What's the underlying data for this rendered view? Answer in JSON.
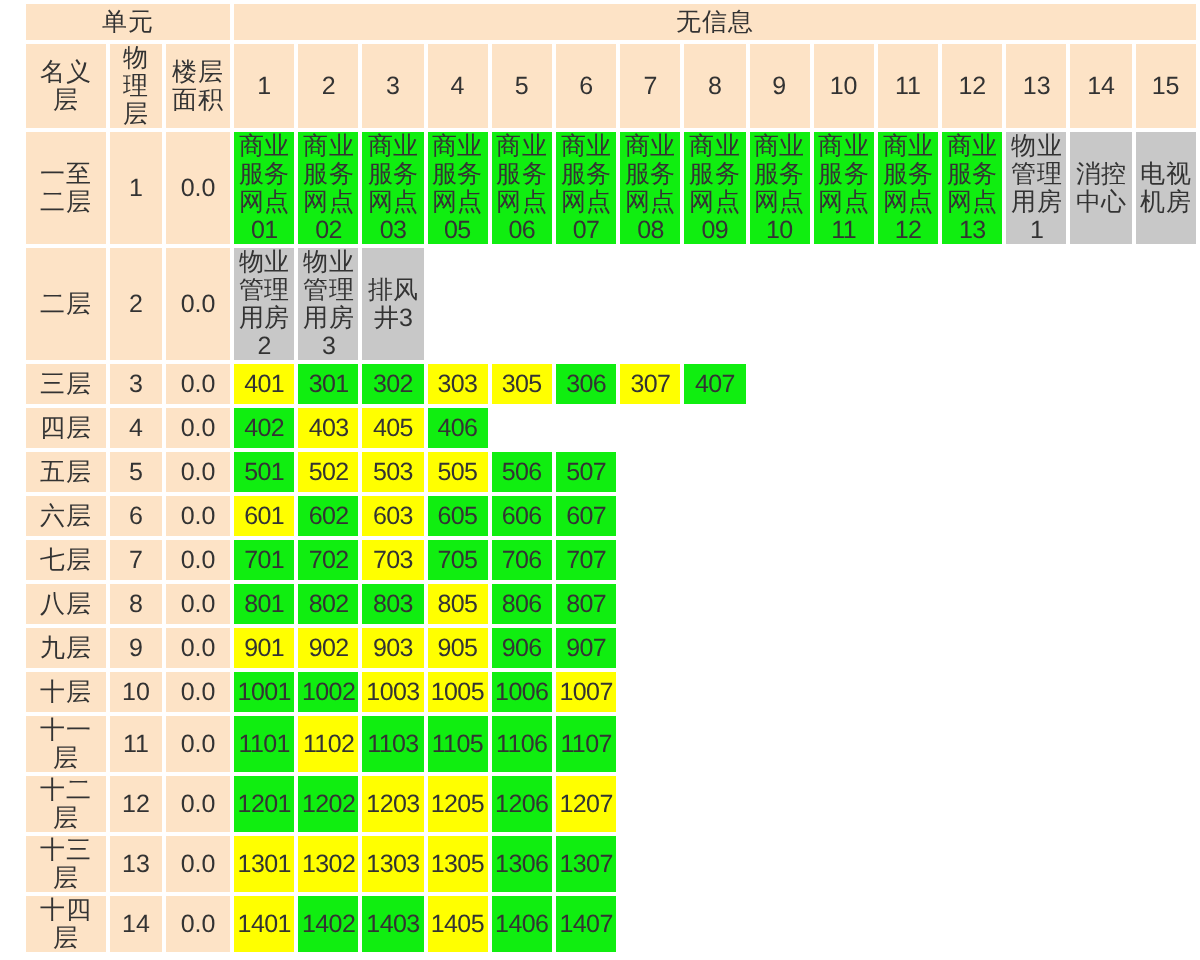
{
  "header": {
    "unit_label": "单元",
    "info_label": "无信息",
    "columns": [
      "名义层",
      "物理层",
      "楼层面积"
    ],
    "unit_numbers": [
      "1",
      "2",
      "3",
      "4",
      "5",
      "6",
      "7",
      "8",
      "9",
      "10",
      "11",
      "12",
      "13",
      "14",
      "15"
    ]
  },
  "floors": [
    {
      "name": "一至二层",
      "physical": "1",
      "area": "0.0",
      "rooms": [
        {
          "label": "商业服务网点01",
          "color": "#10ee10"
        },
        {
          "label": "商业服务网点02",
          "color": "#10ee10"
        },
        {
          "label": "商业服务网点03",
          "color": "#10ee10"
        },
        {
          "label": "商业服务网点05",
          "color": "#10ee10"
        },
        {
          "label": "商业服务网点06",
          "color": "#10ee10"
        },
        {
          "label": "商业服务网点07",
          "color": "#10ee10"
        },
        {
          "label": "商业服务网点08",
          "color": "#10ee10"
        },
        {
          "label": "商业服务网点09",
          "color": "#10ee10"
        },
        {
          "label": "商业服务网点10",
          "color": "#10ee10"
        },
        {
          "label": "商业服务网点11",
          "color": "#10ee10"
        },
        {
          "label": "商业服务网点12",
          "color": "#10ee10"
        },
        {
          "label": "商业服务网点13",
          "color": "#10ee10"
        },
        {
          "label": "物业管理用房1",
          "color": "#c8c8c8"
        },
        {
          "label": "消控中心",
          "color": "#c8c8c8"
        },
        {
          "label": "电视机房",
          "color": "#c8c8c8"
        }
      ]
    },
    {
      "name": "二层",
      "physical": "2",
      "area": "0.0",
      "rooms": [
        {
          "label": "物业管理用房2",
          "color": "#c8c8c8"
        },
        {
          "label": "物业管理用房3",
          "color": "#c8c8c8"
        },
        {
          "label": "排风井3",
          "color": "#c8c8c8"
        }
      ]
    },
    {
      "name": "三层",
      "physical": "3",
      "area": "0.0",
      "rooms": [
        {
          "label": "401",
          "color": "#ffff00"
        },
        {
          "label": "301",
          "color": "#10ee10"
        },
        {
          "label": "302",
          "color": "#10ee10"
        },
        {
          "label": "303",
          "color": "#ffff00"
        },
        {
          "label": "305",
          "color": "#ffff00"
        },
        {
          "label": "306",
          "color": "#10ee10"
        },
        {
          "label": "307",
          "color": "#ffff00"
        },
        {
          "label": "407",
          "color": "#10ee10"
        }
      ]
    },
    {
      "name": "四层",
      "physical": "4",
      "area": "0.0",
      "rooms": [
        {
          "label": "402",
          "color": "#10ee10"
        },
        {
          "label": "403",
          "color": "#ffff00"
        },
        {
          "label": "405",
          "color": "#ffff00"
        },
        {
          "label": "406",
          "color": "#10ee10"
        }
      ]
    },
    {
      "name": "五层",
      "physical": "5",
      "area": "0.0",
      "rooms": [
        {
          "label": "501",
          "color": "#10ee10"
        },
        {
          "label": "502",
          "color": "#ffff00"
        },
        {
          "label": "503",
          "color": "#ffff00"
        },
        {
          "label": "505",
          "color": "#ffff00"
        },
        {
          "label": "506",
          "color": "#10ee10"
        },
        {
          "label": "507",
          "color": "#10ee10"
        }
      ]
    },
    {
      "name": "六层",
      "physical": "6",
      "area": "0.0",
      "rooms": [
        {
          "label": "601",
          "color": "#ffff00"
        },
        {
          "label": "602",
          "color": "#10ee10"
        },
        {
          "label": "603",
          "color": "#ffff00"
        },
        {
          "label": "605",
          "color": "#10ee10"
        },
        {
          "label": "606",
          "color": "#10ee10"
        },
        {
          "label": "607",
          "color": "#10ee10"
        }
      ]
    },
    {
      "name": "七层",
      "physical": "7",
      "area": "0.0",
      "rooms": [
        {
          "label": "701",
          "color": "#10ee10"
        },
        {
          "label": "702",
          "color": "#10ee10"
        },
        {
          "label": "703",
          "color": "#ffff00"
        },
        {
          "label": "705",
          "color": "#10ee10"
        },
        {
          "label": "706",
          "color": "#10ee10"
        },
        {
          "label": "707",
          "color": "#10ee10"
        }
      ]
    },
    {
      "name": "八层",
      "physical": "8",
      "area": "0.0",
      "rooms": [
        {
          "label": "801",
          "color": "#10ee10"
        },
        {
          "label": "802",
          "color": "#10ee10"
        },
        {
          "label": "803",
          "color": "#10ee10"
        },
        {
          "label": "805",
          "color": "#ffff00"
        },
        {
          "label": "806",
          "color": "#10ee10"
        },
        {
          "label": "807",
          "color": "#10ee10"
        }
      ]
    },
    {
      "name": "九层",
      "physical": "9",
      "area": "0.0",
      "rooms": [
        {
          "label": "901",
          "color": "#ffff00"
        },
        {
          "label": "902",
          "color": "#ffff00"
        },
        {
          "label": "903",
          "color": "#ffff00"
        },
        {
          "label": "905",
          "color": "#ffff00"
        },
        {
          "label": "906",
          "color": "#10ee10"
        },
        {
          "label": "907",
          "color": "#10ee10"
        }
      ]
    },
    {
      "name": "十层",
      "physical": "10",
      "area": "0.0",
      "rooms": [
        {
          "label": "1001",
          "color": "#10ee10"
        },
        {
          "label": "1002",
          "color": "#10ee10"
        },
        {
          "label": "1003",
          "color": "#ffff00"
        },
        {
          "label": "1005",
          "color": "#ffff00"
        },
        {
          "label": "1006",
          "color": "#10ee10"
        },
        {
          "label": "1007",
          "color": "#ffff00"
        }
      ]
    },
    {
      "name": "十一层",
      "physical": "11",
      "area": "0.0",
      "rooms": [
        {
          "label": "1101",
          "color": "#10ee10"
        },
        {
          "label": "1102",
          "color": "#ffff00"
        },
        {
          "label": "1103",
          "color": "#10ee10"
        },
        {
          "label": "1105",
          "color": "#10ee10"
        },
        {
          "label": "1106",
          "color": "#10ee10"
        },
        {
          "label": "1107",
          "color": "#10ee10"
        }
      ]
    },
    {
      "name": "十二层",
      "physical": "12",
      "area": "0.0",
      "rooms": [
        {
          "label": "1201",
          "color": "#10ee10"
        },
        {
          "label": "1202",
          "color": "#10ee10"
        },
        {
          "label": "1203",
          "color": "#ffff00"
        },
        {
          "label": "1205",
          "color": "#ffff00"
        },
        {
          "label": "1206",
          "color": "#10ee10"
        },
        {
          "label": "1207",
          "color": "#ffff00"
        }
      ]
    },
    {
      "name": "十三层",
      "physical": "13",
      "area": "0.0",
      "rooms": [
        {
          "label": "1301",
          "color": "#ffff00"
        },
        {
          "label": "1302",
          "color": "#ffff00"
        },
        {
          "label": "1303",
          "color": "#ffff00"
        },
        {
          "label": "1305",
          "color": "#ffff00"
        },
        {
          "label": "1306",
          "color": "#10ee10"
        },
        {
          "label": "1307",
          "color": "#10ee10"
        }
      ]
    },
    {
      "name": "十四层",
      "physical": "14",
      "area": "0.0",
      "rooms": [
        {
          "label": "1401",
          "color": "#ffff00"
        },
        {
          "label": "1402",
          "color": "#10ee10"
        },
        {
          "label": "1403",
          "color": "#10ee10"
        },
        {
          "label": "1405",
          "color": "#ffff00"
        },
        {
          "label": "1406",
          "color": "#10ee10"
        },
        {
          "label": "1407",
          "color": "#10ee10"
        }
      ]
    }
  ]
}
